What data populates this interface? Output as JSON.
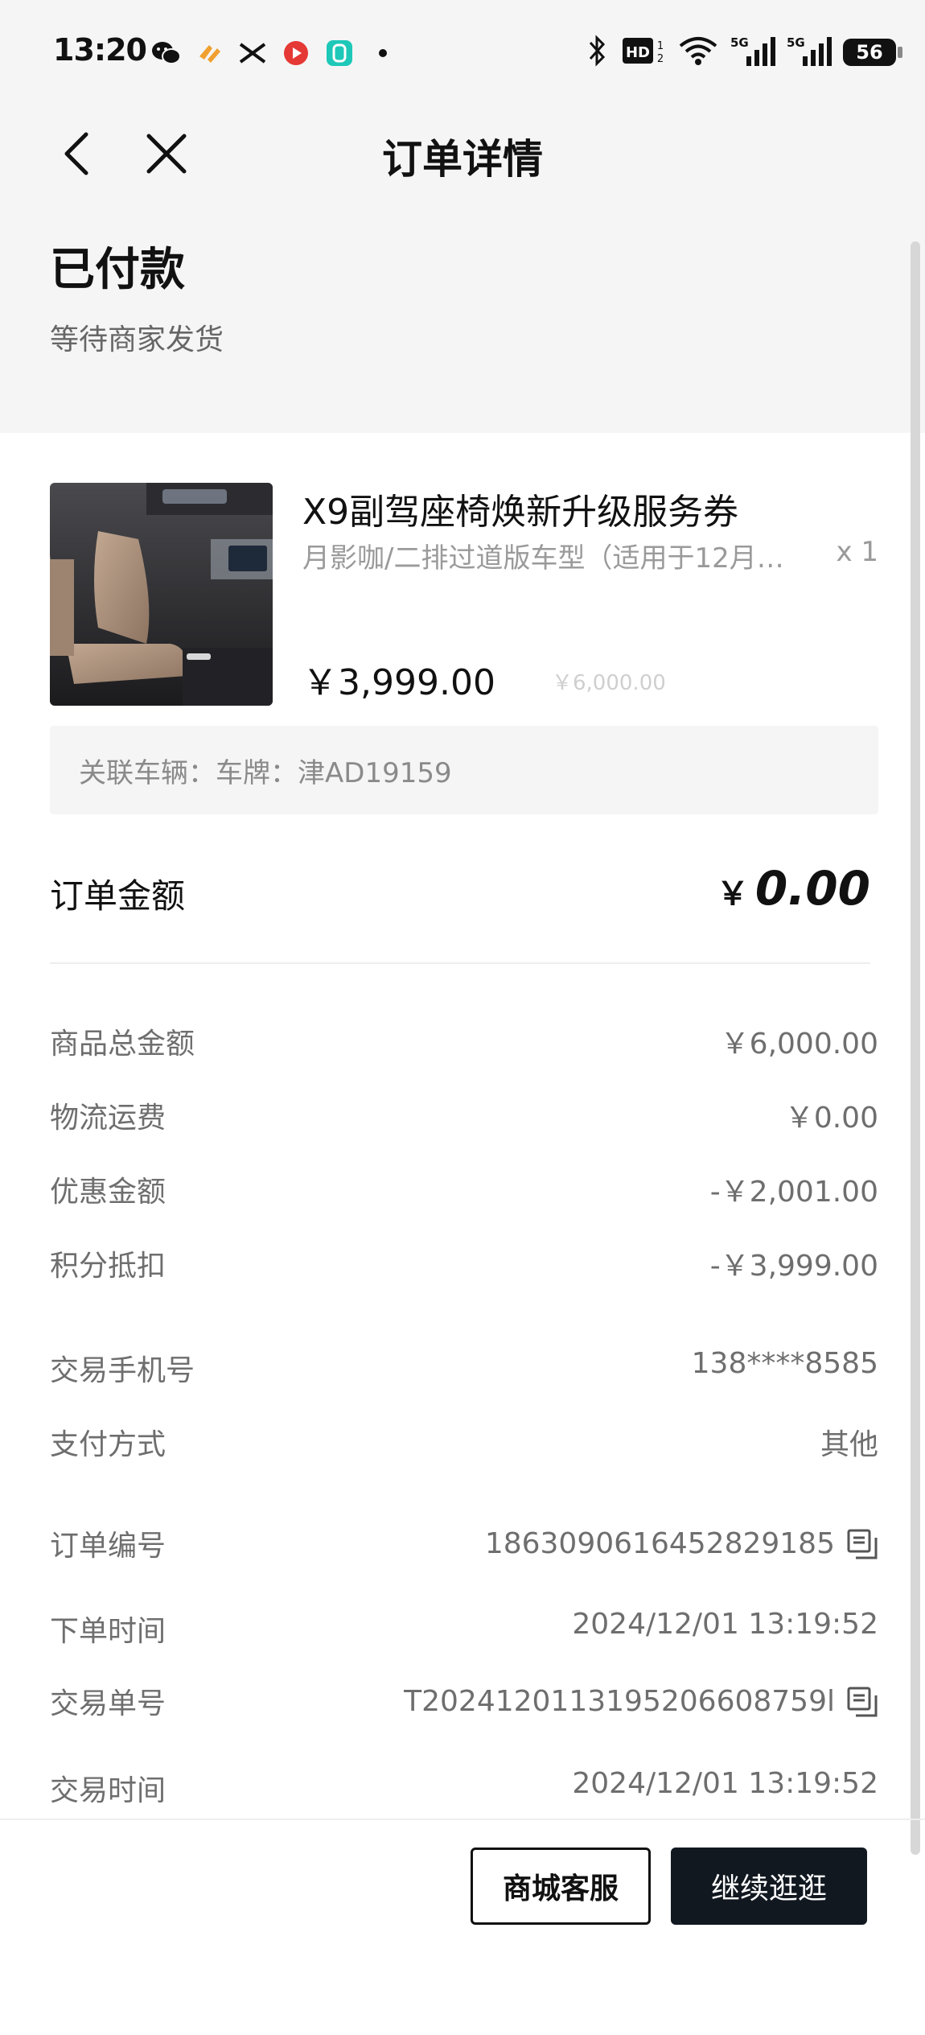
{
  "status_bar": {
    "time": "13:20",
    "battery": "56",
    "notification_icons": [
      "wechat-icon",
      "heart-app-icon",
      "x-app-icon",
      "red-app-icon",
      "teal-app-icon",
      "more-dot-icon"
    ],
    "system_icons": [
      "bluetooth-icon",
      "hd-icon",
      "wifi-icon",
      "signal-5g-icon",
      "signal-5g-icon-2",
      "battery-icon"
    ]
  },
  "nav": {
    "title": "订单详情"
  },
  "order_status": {
    "title": "已付款",
    "subtitle": "等待商家发货"
  },
  "product": {
    "name": "X9副驾座椅焕新升级服务券",
    "spec": "月影咖/二排过道版车型（适用于12月…",
    "quantity": "x 1",
    "price": "￥3,999.00",
    "original_price": "￥6,000.00"
  },
  "vehicle": {
    "text": "关联车辆：车牌：津AD19159"
  },
  "order_amount": {
    "label": "订单金额",
    "currency": "￥",
    "value": "0.00"
  },
  "details": [
    {
      "label": "商品总金额",
      "value": "￥6,000.00"
    },
    {
      "label": "物流运费",
      "value": "￥0.00"
    },
    {
      "label": "优惠金额",
      "value": "-￥2,001.00"
    },
    {
      "label": "积分抵扣",
      "value": "-￥3,999.00"
    },
    {
      "label": "交易手机号",
      "value": "138****8585"
    },
    {
      "label": "支付方式",
      "value": "其他"
    },
    {
      "label": "订单编号",
      "value": "1863090616452829185"
    },
    {
      "label": "下单时间",
      "value": "2024/12/01 13:19:52"
    },
    {
      "label": "交易单号",
      "value": "T2024120113195206608759l"
    },
    {
      "label": "交易时间",
      "value": "2024/12/01 13:19:52"
    }
  ],
  "buttons": {
    "service": "商城客服",
    "continue": "继续逛逛"
  },
  "colors": {
    "primary_button": "#111820",
    "page_gray": "#f5f5f5"
  }
}
